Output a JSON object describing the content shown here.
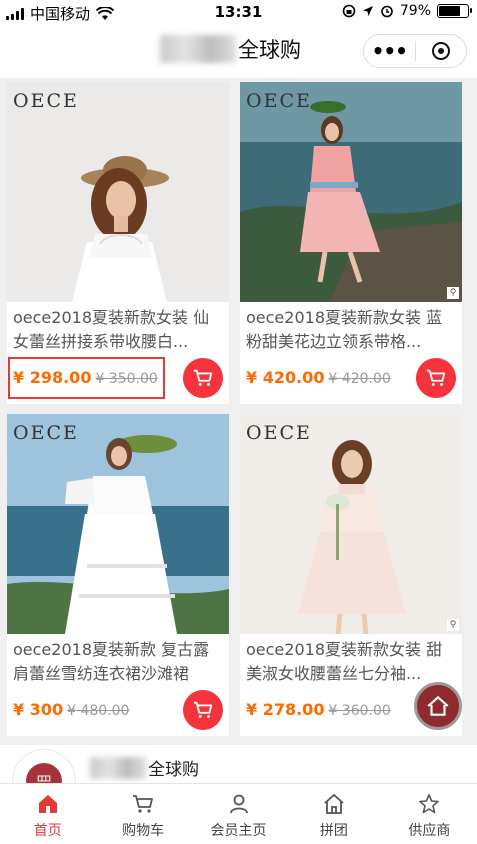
{
  "status": {
    "carrier": "中国移动",
    "time": "13:31",
    "battery": "79%",
    "battery_level": 0.79
  },
  "header": {
    "title": "全球购"
  },
  "products": [
    {
      "title": "oece2018夏装新款女装 仙女蕾丝拼接系带收腰白...",
      "price": "¥ 298.00",
      "old_price": "¥ 350.00",
      "brand": "OECE"
    },
    {
      "title": "oece2018夏装新款女装 蓝粉甜美花边立领系带格...",
      "price": "¥ 420.00",
      "old_price": "¥ 420.00",
      "brand": "OECE"
    },
    {
      "title": "oece2018夏装新款 复古露肩蕾丝雪纺连衣裙沙滩裙",
      "price": "¥ 300",
      "old_price": "¥ 480.00",
      "brand": "OECE"
    },
    {
      "title": "oece2018夏装新款女装 甜美淑女收腰蕾丝七分袖...",
      "price": "¥ 278.00",
      "old_price": "¥ 360.00",
      "brand": "OECE"
    }
  ],
  "shop": {
    "name": "全球购",
    "logo_text": "罒"
  },
  "tabbar": {
    "items": [
      {
        "label": "首页",
        "icon": "home-icon"
      },
      {
        "label": "购物车",
        "icon": "cart-icon"
      },
      {
        "label": "会员主页",
        "icon": "user-icon"
      },
      {
        "label": "拼团",
        "icon": "house-icon"
      },
      {
        "label": "供应商",
        "icon": "star-icon"
      }
    ]
  },
  "colors": {
    "accent": "#e4393c",
    "price": "#ff6a00",
    "cart_button": "#f5333c"
  }
}
